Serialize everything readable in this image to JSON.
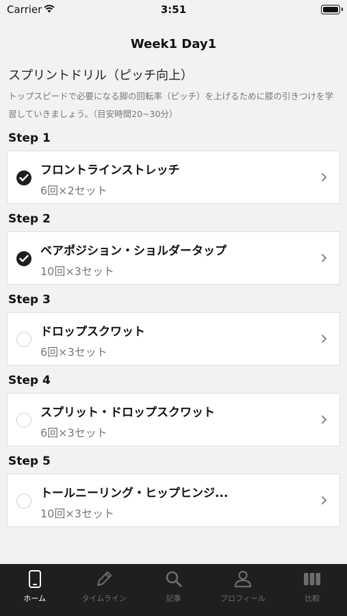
{
  "status_bar": {
    "carrier": "Carrier",
    "time": "3:51"
  },
  "nav": {
    "title": "Week1  Day1"
  },
  "program": {
    "title": "スプリントドリル（ピッチ向上）",
    "description": "トップスピードで必要になる脚の回転率（ピッチ）を上げるために膝の引きつけを学習していきましょう。（目安時間20~30分）"
  },
  "steps": [
    {
      "label": "Step 1",
      "title": "フロントラインストレッチ",
      "sub": "6回×2セット",
      "done": true
    },
    {
      "label": "Step 2",
      "title": "ベアポジション・ショルダータップ",
      "sub": "10回×3セット",
      "done": true
    },
    {
      "label": "Step 3",
      "title": "ドロップスクワット",
      "sub": "6回×3セット",
      "done": false
    },
    {
      "label": "Step 4",
      "title": "スプリット・ドロップスクワット",
      "sub": "6回×3セット",
      "done": false
    },
    {
      "label": "Step 5",
      "title": "トールニーリング・ヒップヒンジ...",
      "sub": "10回×3セット",
      "done": false
    }
  ],
  "tabs": [
    {
      "label": "ホーム",
      "icon": "phone-icon",
      "active": true
    },
    {
      "label": "タイムライン",
      "icon": "pencil-icon",
      "active": false
    },
    {
      "label": "記事",
      "icon": "search-icon",
      "active": false
    },
    {
      "label": "プロフィール",
      "icon": "person-icon",
      "active": false
    },
    {
      "label": "比較",
      "icon": "bars-icon",
      "active": false
    }
  ]
}
